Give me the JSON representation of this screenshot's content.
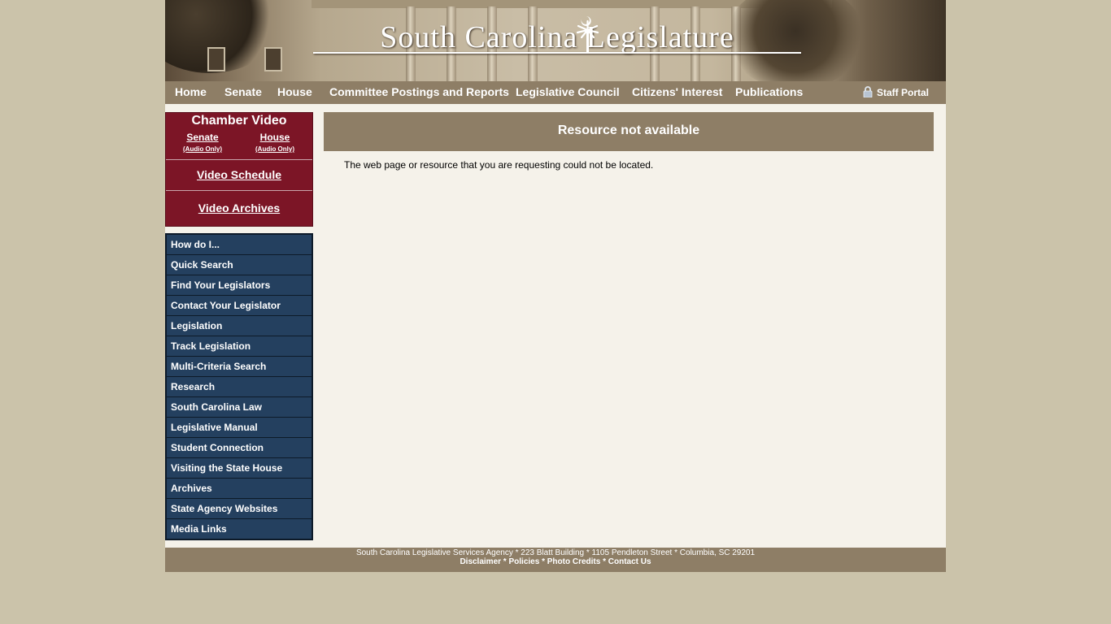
{
  "banner": {
    "site_title": "South Carolina Legislature"
  },
  "nav": {
    "items": [
      "Home",
      "Senate",
      "House",
      "Committee Postings and Reports",
      "Legislative Council",
      "Citizens' Interest",
      "Publications"
    ],
    "staff_portal": "Staff Portal"
  },
  "video": {
    "title": "Chamber Video",
    "senate": "Senate",
    "house": "House",
    "audio_only": "(Audio Only)",
    "schedule": "Video Schedule",
    "archives": "Video Archives"
  },
  "side_menu": {
    "items": [
      "How do I...",
      "Quick Search",
      "Find Your Legislators",
      "Contact Your Legislator",
      "Legislation",
      "Track Legislation",
      "Multi-Criteria Search",
      "Research",
      "South Carolina Law",
      "Legislative Manual",
      "Student Connection",
      "Visiting the State House",
      "Archives",
      "State Agency Websites",
      "Media Links"
    ]
  },
  "main": {
    "heading": "Resource not available",
    "message": "The web page or resource that you are requesting could not be located."
  },
  "footer": {
    "address": "South Carolina Legislative Services Agency * 223 Blatt Building * 1105 Pendleton Street * Columbia, SC 29201",
    "links": [
      "Disclaimer",
      "Policies",
      "Photo Credits",
      "Contact Us"
    ],
    "separator": " * "
  },
  "colors": {
    "page_bg": "#cbc3aa",
    "nav_bg": "#8e7e66",
    "video_bg": "#7c1526",
    "menu_bg": "#24405f",
    "content_bg": "#f5f2ea"
  },
  "icons": {
    "staff_portal": "lock-icon",
    "banner_emblem": "palmetto-tree-icon"
  }
}
